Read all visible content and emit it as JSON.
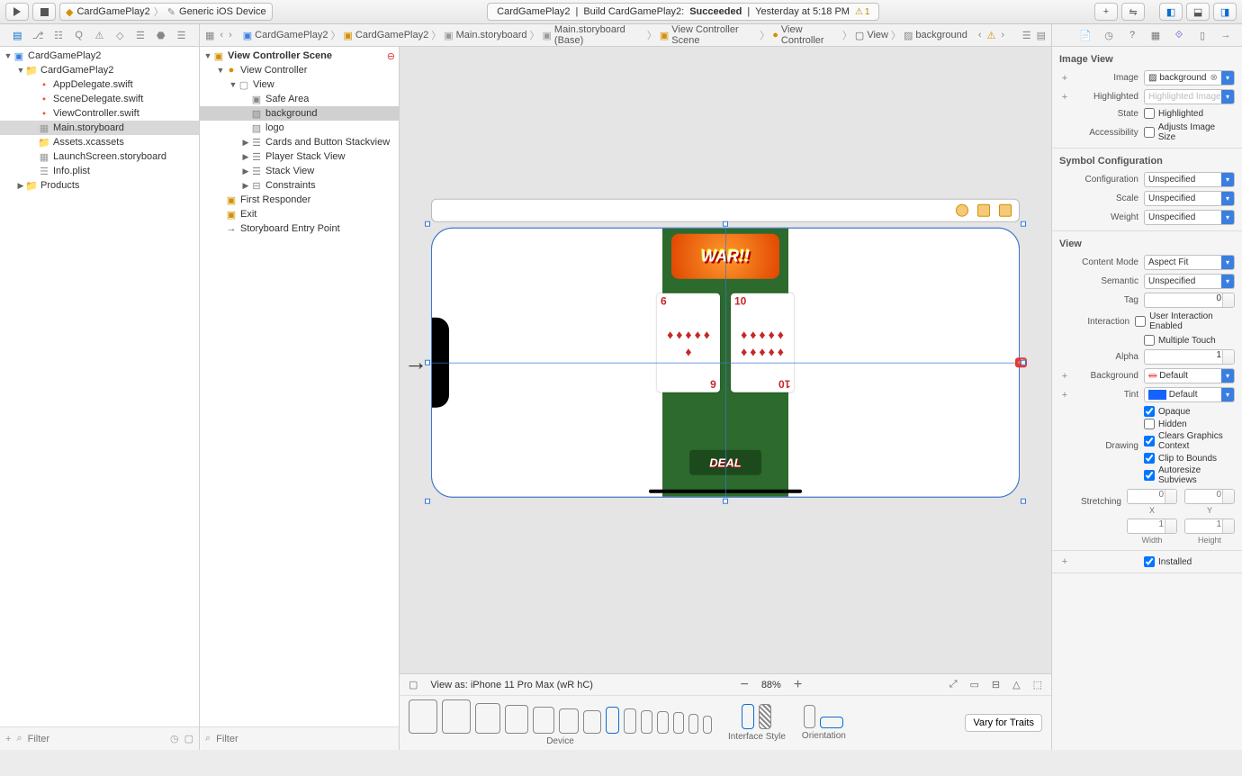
{
  "toolbar": {
    "scheme_app": "CardGamePlay2",
    "scheme_device": "Generic iOS Device",
    "status_project": "CardGamePlay2",
    "status_action": "Build CardGamePlay2:",
    "status_result": "Succeeded",
    "status_time": "Yesterday at 5:18 PM",
    "warn_count": "1"
  },
  "breadcrumb": [
    "CardGamePlay2",
    "CardGamePlay2",
    "Main.storyboard",
    "Main.storyboard (Base)",
    "View Controller Scene",
    "View Controller",
    "View",
    "background"
  ],
  "navigator": {
    "items": [
      {
        "indent": 0,
        "disc": "▼",
        "icon": "app",
        "label": "CardGamePlay2"
      },
      {
        "indent": 1,
        "disc": "▼",
        "icon": "folder",
        "label": "CardGamePlay2"
      },
      {
        "indent": 2,
        "disc": "",
        "icon": "swift",
        "label": "AppDelegate.swift"
      },
      {
        "indent": 2,
        "disc": "",
        "icon": "swift",
        "label": "SceneDelegate.swift"
      },
      {
        "indent": 2,
        "disc": "",
        "icon": "swift",
        "label": "ViewController.swift"
      },
      {
        "indent": 2,
        "disc": "",
        "icon": "sb",
        "label": "Main.storyboard",
        "sel": true
      },
      {
        "indent": 2,
        "disc": "",
        "icon": "folder",
        "label": "Assets.xcassets"
      },
      {
        "indent": 2,
        "disc": "",
        "icon": "sb",
        "label": "LaunchScreen.storyboard"
      },
      {
        "indent": 2,
        "disc": "",
        "icon": "plist",
        "label": "Info.plist"
      },
      {
        "indent": 1,
        "disc": "▶",
        "icon": "folder",
        "label": "Products"
      }
    ]
  },
  "outline": {
    "header": "View Controller Scene",
    "items": [
      {
        "indent": 0,
        "disc": "▼",
        "icon": "scene",
        "label": "View Controller Scene"
      },
      {
        "indent": 1,
        "disc": "▼",
        "icon": "vc",
        "label": "View Controller"
      },
      {
        "indent": 2,
        "disc": "▼",
        "icon": "view",
        "label": "View"
      },
      {
        "indent": 3,
        "disc": "",
        "icon": "safe",
        "label": "Safe Area"
      },
      {
        "indent": 3,
        "disc": "",
        "icon": "img",
        "label": "background",
        "sel": true
      },
      {
        "indent": 3,
        "disc": "",
        "icon": "img",
        "label": "logo"
      },
      {
        "indent": 3,
        "disc": "▶",
        "icon": "stack",
        "label": "Cards and Button Stackview"
      },
      {
        "indent": 3,
        "disc": "▶",
        "icon": "stack",
        "label": "Player Stack View"
      },
      {
        "indent": 3,
        "disc": "▶",
        "icon": "stack",
        "label": "Stack View"
      },
      {
        "indent": 3,
        "disc": "▶",
        "icon": "cons",
        "label": "Constraints"
      },
      {
        "indent": 1,
        "disc": "",
        "icon": "resp",
        "label": "First Responder"
      },
      {
        "indent": 1,
        "disc": "",
        "icon": "exit",
        "label": "Exit"
      },
      {
        "indent": 1,
        "disc": "",
        "icon": "entry",
        "label": "Storyboard Entry Point"
      }
    ]
  },
  "canvas": {
    "logo_text": "WAR!!",
    "deal_text": "DEAL",
    "card_left": "6",
    "card_right": "10",
    "view_as": "View as: iPhone 11 Pro Max (wR hC)",
    "zoom": "88%",
    "device_label": "Device",
    "style_label": "Interface Style",
    "orient_label": "Orientation",
    "vary": "Vary for Traits"
  },
  "inspector": {
    "section_imageview": "Image View",
    "image_label": "Image",
    "image_value": "background",
    "highlighted_label": "Highlighted",
    "highlighted_ph": "Highlighted Image",
    "state_label": "State",
    "state_check": "Highlighted",
    "access_label": "Accessibility",
    "access_check": "Adjusts Image Size",
    "section_symbol": "Symbol Configuration",
    "config_label": "Configuration",
    "config_value": "Unspecified",
    "scale_label": "Scale",
    "scale_value": "Unspecified",
    "weight_label": "Weight",
    "weight_value": "Unspecified",
    "section_view": "View",
    "cmode_label": "Content Mode",
    "cmode_value": "Aspect Fit",
    "semantic_label": "Semantic",
    "semantic_value": "Unspecified",
    "tag_label": "Tag",
    "tag_value": "0",
    "interaction_label": "Interaction",
    "interaction_check1": "User Interaction Enabled",
    "interaction_check2": "Multiple Touch",
    "alpha_label": "Alpha",
    "alpha_value": "1",
    "bg_label": "Background",
    "bg_value": "Default",
    "tint_label": "Tint",
    "tint_value": "Default",
    "drawing_label": "Drawing",
    "drawing_checks": [
      "Opaque",
      "Hidden",
      "Clears Graphics Context",
      "Clip to Bounds",
      "Autoresize Subviews"
    ],
    "drawing_states": [
      true,
      false,
      true,
      true,
      true
    ],
    "stretch_label": "Stretching",
    "stretch_x": "0",
    "stretch_y": "0",
    "stretch_w": "1",
    "stretch_h": "1",
    "x_label": "X",
    "y_label": "Y",
    "w_label": "Width",
    "h_label": "Height",
    "installed": "Installed"
  },
  "filter_placeholder": "Filter"
}
